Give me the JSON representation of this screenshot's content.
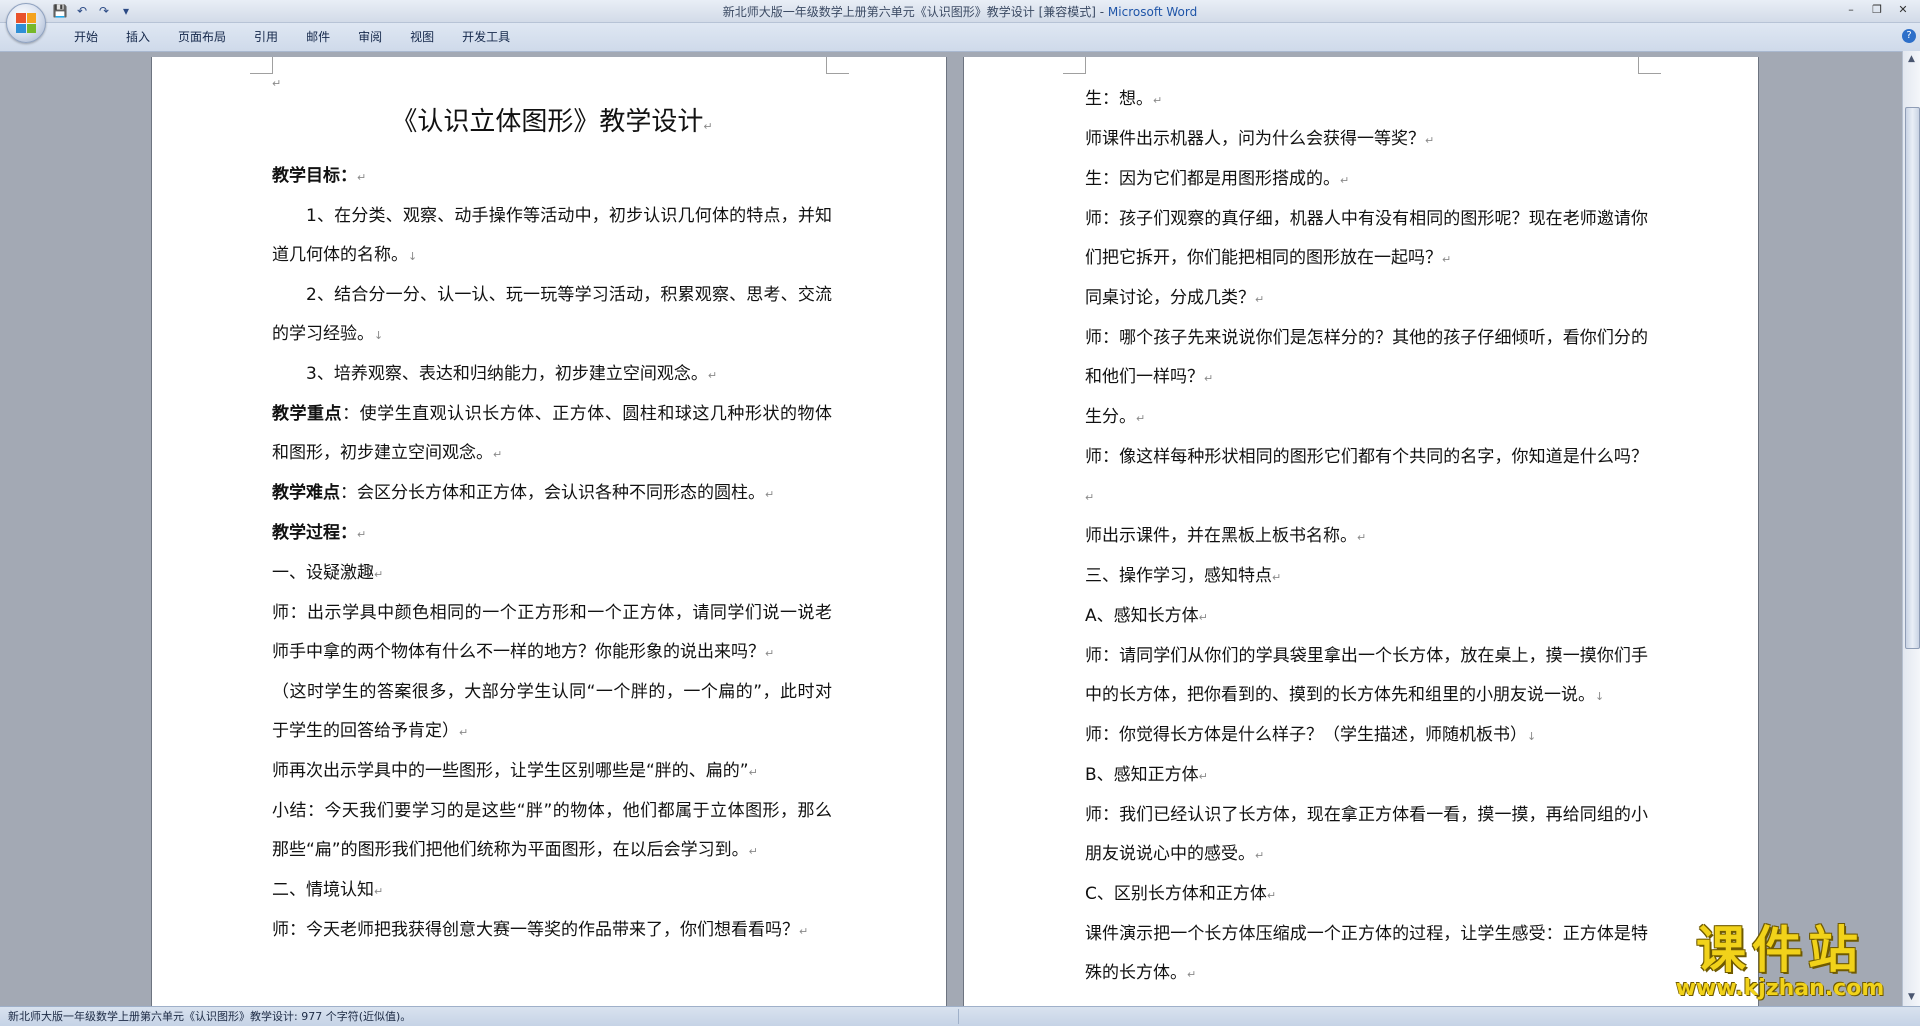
{
  "window": {
    "title": "新北师大版一年级数学上册第六单元《认识图形》教学设计 [兼容模式] - ",
    "app_name": "Microsoft Word",
    "controls": [
      "–",
      "❐",
      "✕"
    ]
  },
  "quick_access": [
    "💾",
    "↶",
    "↷",
    "▾"
  ],
  "ribbon": {
    "tabs": [
      "开始",
      "插入",
      "页面布局",
      "引用",
      "邮件",
      "审阅",
      "视图",
      "开发工具"
    ],
    "help": "?"
  },
  "left_page": {
    "title": "《认识立体图形》教学设计",
    "objectives_label": "教学目标：",
    "objectives": [
      "1、在分类、观察、动手操作等活动中，初步认识几何体的特点，并知道几何体的名称。",
      "2、结合分一分、认一认、玩一玩等学习活动，积累观察、思考、交流的学习经验。",
      "3、培养观察、表达和归纳能力，初步建立空间观念。"
    ],
    "key_label": "教学重点",
    "key_text": "：使学生直观认识长方体、正方体、圆柱和球这几种形状的物体和图形，初步建立空间观念。",
    "difficulty_label": "教学难点",
    "difficulty_text": "：会区分长方体和正方体，会认识各种不同形态的圆柱。",
    "process_label": "教学过程：",
    "paragraphs": [
      "一、设疑激趣",
      "师：出示学具中颜色相同的一个正方形和一个正方体，请同学们说一说老师手中拿的两个物体有什么不一样的地方？你能形象的说出来吗？",
      "（这时学生的答案很多，大部分学生认同“一个胖的，一个扁的”，此时对于学生的回答给予肯定）",
      "师再次出示学具中的一些图形，让学生区别哪些是“胖的、扁的”",
      "小结：今天我们要学习的是这些“胖”的物体，他们都属于立体图形，那么那些“扁”的图形我们把他们统称为平面图形，在以后会学习到。",
      "二、情境认知",
      "师：今天老师把我获得创意大赛一等奖的作品带来了，你们想看看吗？"
    ]
  },
  "right_page": {
    "paragraphs": [
      "生：想。",
      "师课件出示机器人，问为什么会获得一等奖？",
      "生：因为它们都是用图形搭成的。",
      "师：孩子们观察的真仔细，机器人中有没有相同的图形呢？现在老师邀请你们把它拆开，你们能把相同的图形放在一起吗？",
      "同桌讨论，分成几类？",
      "师：哪个孩子先来说说你们是怎样分的？其他的孩子仔细倾听，看你们分的和他们一样吗？",
      "生分。",
      "师：像这样每种形状相同的图形它们都有个共同的名字，你知道是什么吗？",
      "师出示课件，并在黑板上板书名称。",
      "三、操作学习，感知特点",
      "A、感知长方体",
      "师：请同学们从你们的学具袋里拿出一个长方体，放在桌上，摸一摸你们手中的长方体，把你看到的、摸到的长方体先和组里的小朋友说一说。",
      "师：你觉得长方体是什么样子？（学生描述，师随机板书）",
      "B、感知正方体",
      "师：我们已经认识了长方体，现在拿正方体看一看，摸一摸，再给同组的小朋友说说心中的感受。",
      "C、区别长方体和正方体",
      "课件演示把一个长方体压缩成一个正方体的过程，让学生感受：正方体是特殊的长方体。"
    ]
  },
  "marks": {
    "para": "↵",
    "line": "↓"
  },
  "status_bar": {
    "text": "新北师大版一年级数学上册第六单元《认识图形》教学设计: 977 个字符(近似值)。"
  },
  "watermark": {
    "main": "课件站",
    "url": "www.kjzhan.com"
  }
}
